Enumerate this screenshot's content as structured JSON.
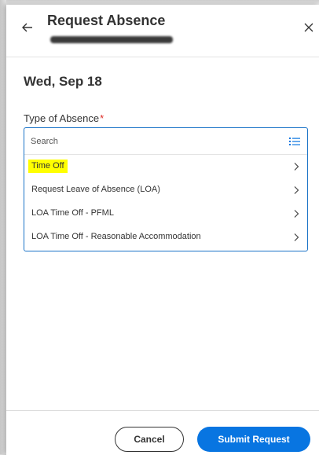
{
  "header": {
    "title": "Request Absence",
    "back_icon": "arrow-left-icon",
    "close_icon": "close-icon"
  },
  "date": "Wed, Sep 18",
  "absence_type": {
    "label": "Type of Absence",
    "required_marker": "*",
    "search_placeholder": "Search",
    "list_icon": "list-icon",
    "options": [
      {
        "label": "Time Off",
        "highlighted": true
      },
      {
        "label": "Request Leave of Absence (LOA)",
        "highlighted": false
      },
      {
        "label": "LOA Time Off - PFML",
        "highlighted": false
      },
      {
        "label": "LOA Time Off - Reasonable Accommodation",
        "highlighted": false
      }
    ]
  },
  "footer": {
    "cancel_label": "Cancel",
    "submit_label": "Submit Request"
  },
  "colors": {
    "accent": "#0875e1",
    "required": "#de2d26",
    "highlight": "#ffff00"
  }
}
